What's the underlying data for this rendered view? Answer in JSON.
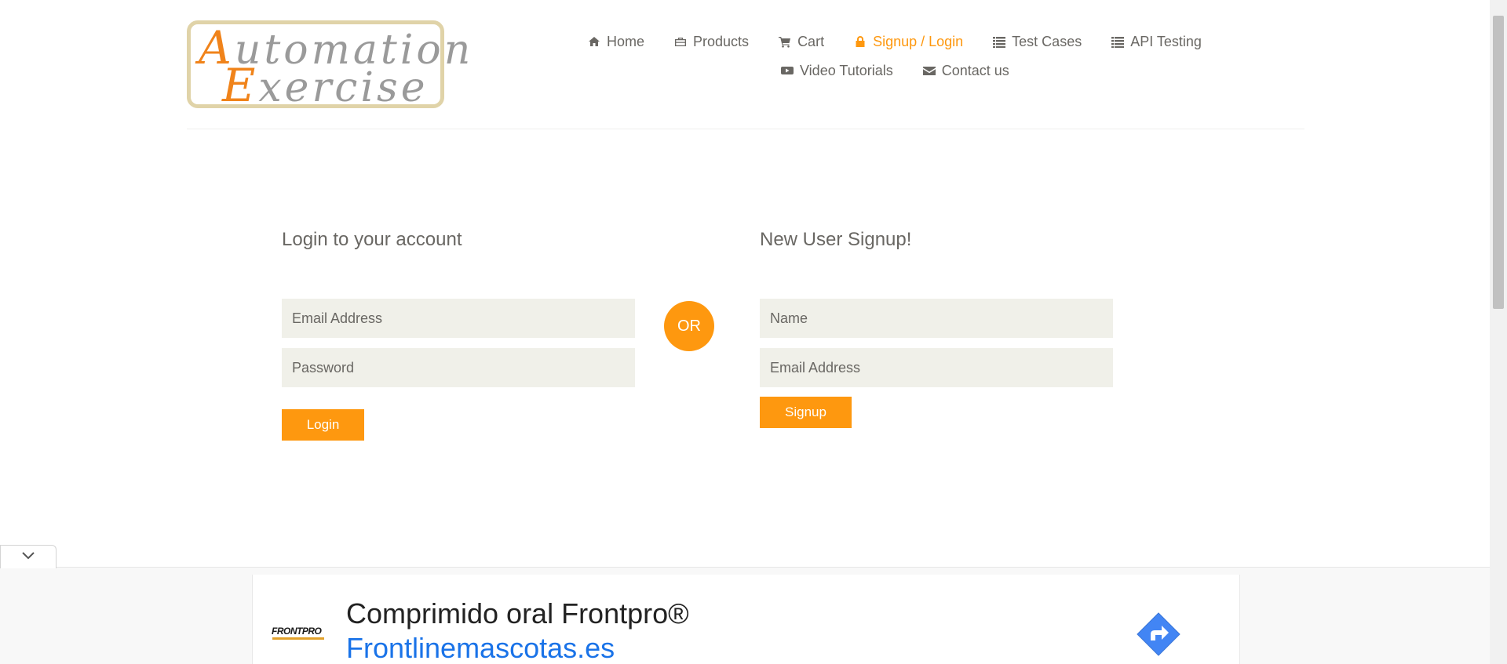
{
  "logo": {
    "line1_cap": "A",
    "line1_rest": "utomation",
    "line2_cap": "E",
    "line2_rest": "xercise"
  },
  "nav": {
    "items": [
      {
        "label": "Home",
        "icon": "home-icon"
      },
      {
        "label": "Products",
        "icon": "briefcase-icon"
      },
      {
        "label": "Cart",
        "icon": "cart-icon"
      },
      {
        "label": "Signup / Login",
        "icon": "lock-icon",
        "active": true
      },
      {
        "label": "Test Cases",
        "icon": "list-icon"
      },
      {
        "label": "API Testing",
        "icon": "list-icon"
      },
      {
        "label": "Video Tutorials",
        "icon": "youtube-play-icon"
      },
      {
        "label": "Contact us",
        "icon": "envelope-icon"
      }
    ]
  },
  "login": {
    "title": "Login to your account",
    "email_placeholder": "Email Address",
    "password_placeholder": "Password",
    "button_label": "Login"
  },
  "divider": {
    "label": "OR"
  },
  "signup": {
    "title": "New User Signup!",
    "name_placeholder": "Name",
    "email_placeholder": "Email Address",
    "button_label": "Signup"
  },
  "ad": {
    "brand": "FRONTPRO",
    "title": "Comprimido oral Frontpro®",
    "url": "Frontlinemascotas.es",
    "collapse_icon": "chevron-down-icon",
    "cta_icon": "directions-arrow-icon"
  },
  "colors": {
    "accent": "#fe980f",
    "text": "#696763",
    "input_bg": "#f0f0e9",
    "link_blue": "#1a73e8"
  }
}
